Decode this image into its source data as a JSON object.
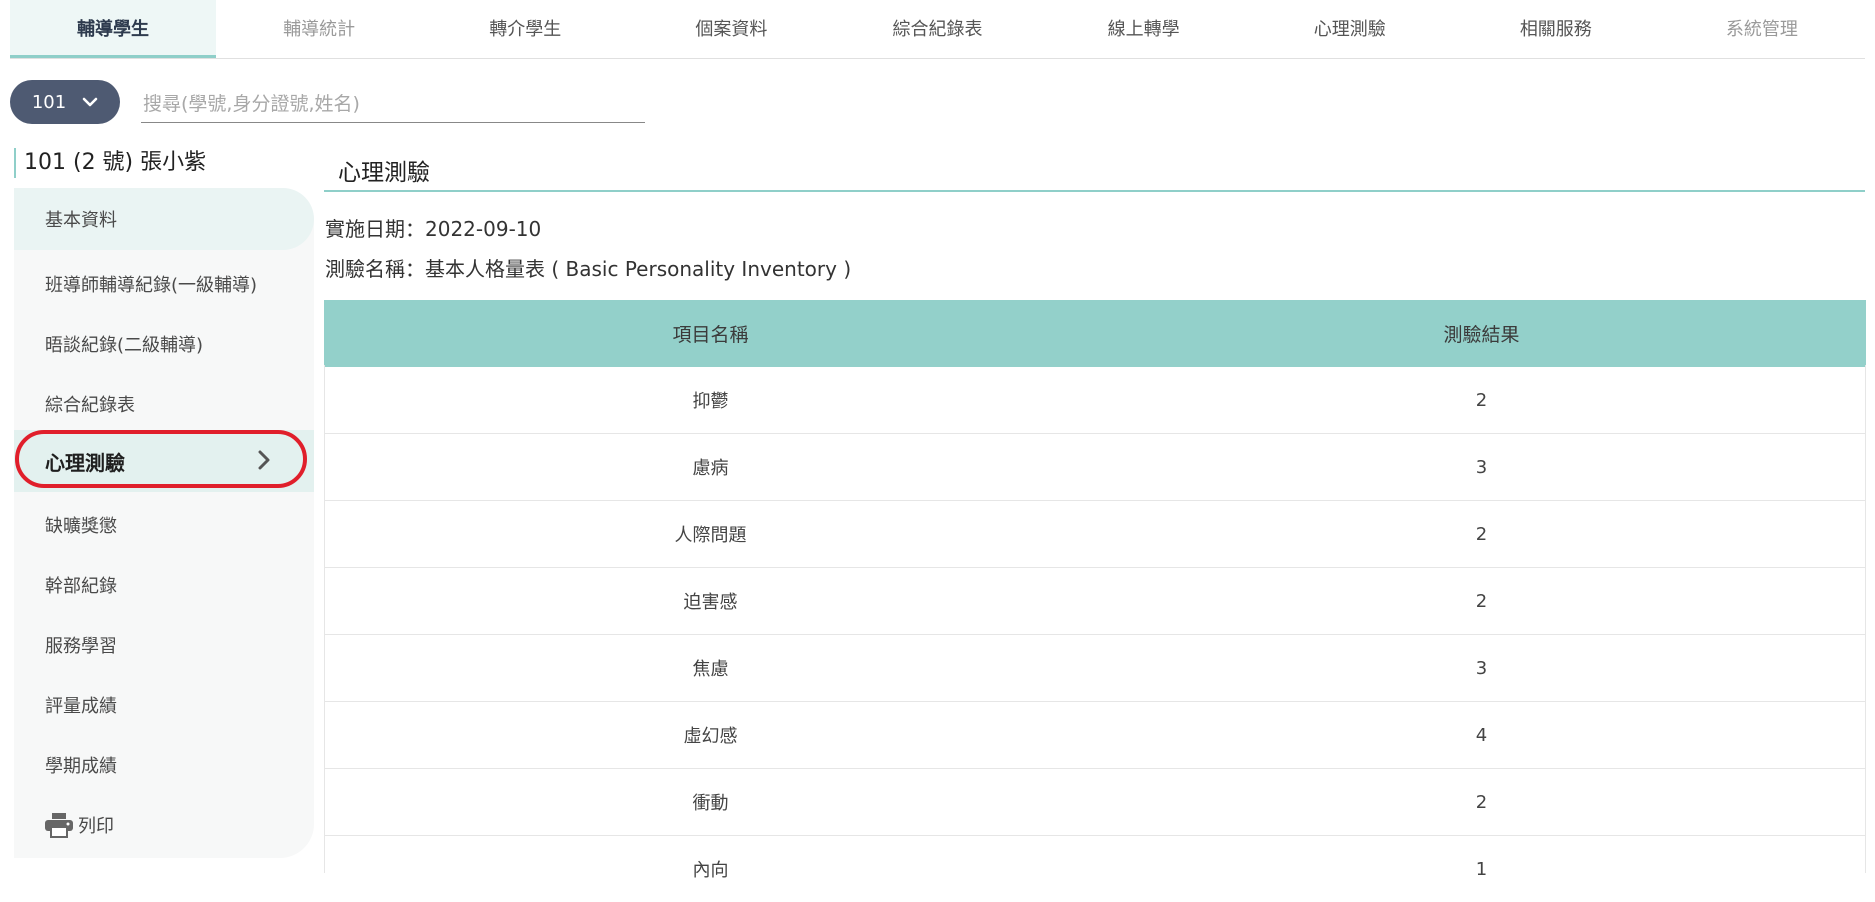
{
  "nav": {
    "tabs": [
      {
        "label": "輔導學生"
      },
      {
        "label": "輔導統計"
      },
      {
        "label": "轉介學生"
      },
      {
        "label": "個案資料"
      },
      {
        "label": "綜合紀錄表"
      },
      {
        "label": "線上轉學"
      },
      {
        "label": "心理測驗"
      },
      {
        "label": "相關服務"
      },
      {
        "label": "系統管理"
      }
    ]
  },
  "class_selector": {
    "value": "101"
  },
  "search": {
    "placeholder": "搜尋(學號,身分證號,姓名)",
    "value": ""
  },
  "student": {
    "label": "101 (2 號) 張小紫"
  },
  "sidebar": {
    "items": [
      {
        "label": "基本資料"
      },
      {
        "label": "班導師輔導紀錄(一級輔導)"
      },
      {
        "label": "晤談紀錄(二級輔導)"
      },
      {
        "label": "綜合紀錄表"
      },
      {
        "label": "心理測驗"
      },
      {
        "label": "缺曠獎懲"
      },
      {
        "label": "幹部紀錄"
      },
      {
        "label": "服務學習"
      },
      {
        "label": "評量成績"
      },
      {
        "label": "學期成績"
      },
      {
        "label": "列印"
      }
    ]
  },
  "content": {
    "title": "心理測驗",
    "date_line": "實施日期：2022-09-10",
    "test_line": "測驗名稱：基本人格量表 ( Basic Personality Inventory )",
    "table": {
      "headers": [
        "項目名稱",
        "測驗結果"
      ],
      "rows": [
        {
          "item": "抑鬱",
          "result": "2"
        },
        {
          "item": "慮病",
          "result": "3"
        },
        {
          "item": "人際問題",
          "result": "2"
        },
        {
          "item": "迫害感",
          "result": "2"
        },
        {
          "item": "焦慮",
          "result": "3"
        },
        {
          "item": "虛幻感",
          "result": "4"
        },
        {
          "item": "衝動",
          "result": "2"
        },
        {
          "item": "內向",
          "result": "1"
        }
      ]
    }
  },
  "colors": {
    "accent": "#8fcfc9",
    "header_bg": "#93d0ca",
    "selector_bg": "#4e5a72",
    "highlight_ring": "#e01f2b"
  }
}
